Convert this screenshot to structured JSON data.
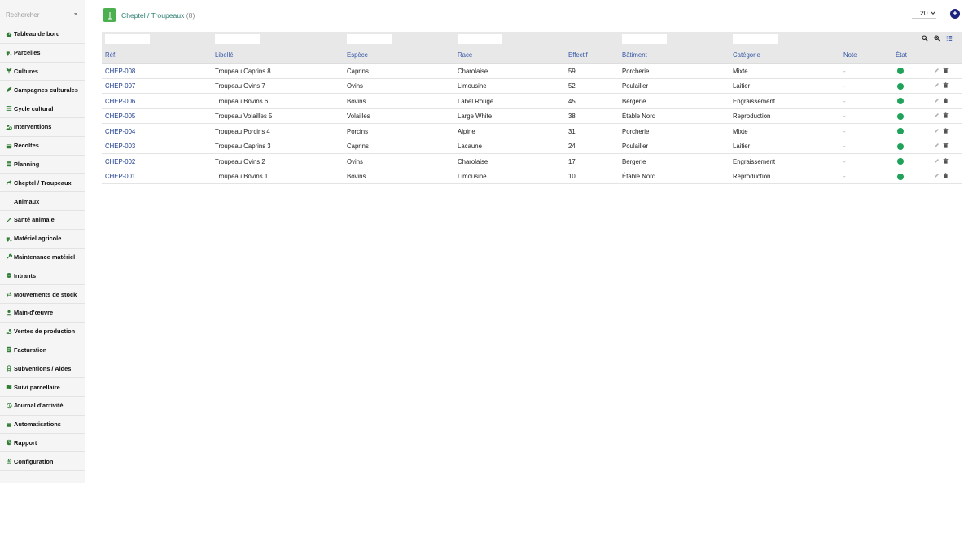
{
  "search": {
    "placeholder": "Rechercher"
  },
  "sidebar": {
    "items": [
      {
        "label": "Tableau de bord",
        "icon": "gauge-icon"
      },
      {
        "label": "Parcelles",
        "icon": "tractor-icon"
      },
      {
        "label": "Cultures",
        "icon": "seedling-icon"
      },
      {
        "label": "Campagnes culturales",
        "icon": "leaf-icon"
      },
      {
        "label": "Cycle cultural",
        "icon": "bars-icon"
      },
      {
        "label": "Interventions",
        "icon": "users-cog-icon"
      },
      {
        "label": "Récoltes",
        "icon": "basket-icon"
      },
      {
        "label": "Planning",
        "icon": "calendar-icon"
      },
      {
        "label": "Cheptel / Troupeaux",
        "icon": "horse-icon"
      },
      {
        "label": "Animaux",
        "icon": ""
      },
      {
        "label": "Santé animale",
        "icon": "syringe-icon"
      },
      {
        "label": "Matériel agricole",
        "icon": "tractor-icon"
      },
      {
        "label": "Maintenance matériel",
        "icon": "wrench-icon"
      },
      {
        "label": "Intrants",
        "icon": "flask-icon"
      },
      {
        "label": "Mouvements de stock",
        "icon": "exchange-icon"
      },
      {
        "label": "Main-d'œuvre",
        "icon": "user-icon"
      },
      {
        "label": "Ventes de production",
        "icon": "hand-dollar-icon"
      },
      {
        "label": "Facturation",
        "icon": "invoice-icon"
      },
      {
        "label": "Subventions / Aides",
        "icon": "award-icon"
      },
      {
        "label": "Suivi parcellaire",
        "icon": "map-icon"
      },
      {
        "label": "Journal d'activité",
        "icon": "history-icon"
      },
      {
        "label": "Automatisations",
        "icon": "robot-icon"
      },
      {
        "label": "Rapport",
        "icon": "chart-pie-icon"
      },
      {
        "label": "Configuration",
        "icon": "gear-icon"
      }
    ]
  },
  "header": {
    "breadcrumb": "Cheptel / Troupeaux",
    "count": "(8)",
    "per_page": "20"
  },
  "table": {
    "columns": [
      "Réf.",
      "Libellé",
      "Espèce",
      "Race",
      "Effectif",
      "Bâtiment",
      "Catégorie",
      "Note",
      "État"
    ],
    "rows": [
      [
        "CHEP-008",
        "Troupeau Caprins 8",
        "Caprins",
        "Charolaise",
        "59",
        "Porcherie",
        "Mixte",
        "-"
      ],
      [
        "CHEP-007",
        "Troupeau Ovins 7",
        "Ovins",
        "Limousine",
        "52",
        "Poulailler",
        "Laitier",
        "-"
      ],
      [
        "CHEP-006",
        "Troupeau Bovins 6",
        "Bovins",
        "Label Rouge",
        "45",
        "Bergerie",
        "Engraissement",
        "-"
      ],
      [
        "CHEP-005",
        "Troupeau Volailles 5",
        "Volailles",
        "Large White",
        "38",
        "Étable Nord",
        "Reproduction",
        "-"
      ],
      [
        "CHEP-004",
        "Troupeau Porcins 4",
        "Porcins",
        "Alpine",
        "31",
        "Porcherie",
        "Mixte",
        "-"
      ],
      [
        "CHEP-003",
        "Troupeau Caprins 3",
        "Caprins",
        "Lacaune",
        "24",
        "Poulailler",
        "Laitier",
        "-"
      ],
      [
        "CHEP-002",
        "Troupeau Ovins 2",
        "Ovins",
        "Charolaise",
        "17",
        "Bergerie",
        "Engraissement",
        "-"
      ],
      [
        "CHEP-001",
        "Troupeau Bovins 1",
        "Bovins",
        "Limousine",
        "10",
        "Étable Nord",
        "Reproduction",
        "-"
      ]
    ],
    "status_color": "#1fa25a"
  },
  "colors": {
    "accent": "#2a7d6e",
    "link": "#1a3a8f",
    "header_link": "#3557a7",
    "add_button": "#1a237e",
    "icon_green": "#2e7d32"
  }
}
